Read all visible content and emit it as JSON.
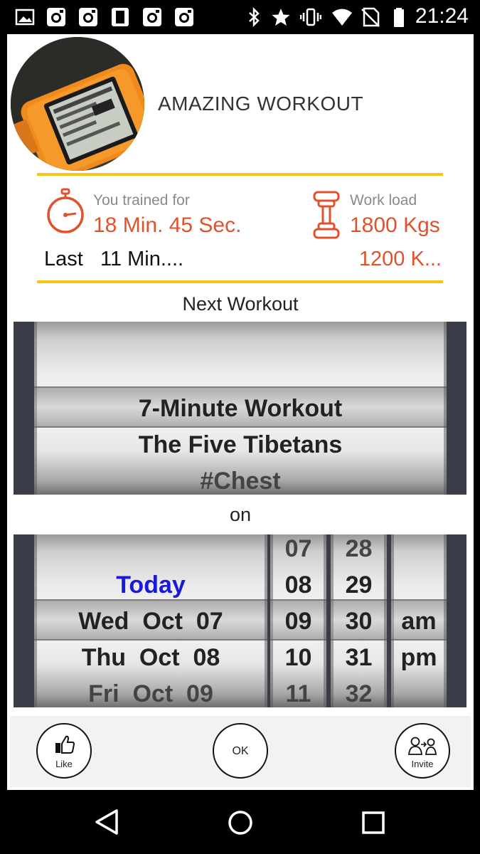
{
  "status_bar": {
    "time": "21:24",
    "left_icons": [
      "image-icon",
      "instagram-icon",
      "instagram-icon",
      "phone-frame-icon",
      "instagram-icon",
      "instagram-icon"
    ],
    "right_icons": [
      "bluetooth-icon",
      "star-icon",
      "vibrate-icon",
      "wifi-icon",
      "no-sim-icon",
      "battery-icon"
    ]
  },
  "header": {
    "title": "AMAZING WORKOUT"
  },
  "stats": {
    "trained_label": "You trained for",
    "trained_value": "18 Min. 45 Sec.",
    "last_label": "Last   11 Min....",
    "load_label": "Work load",
    "load_value": "1800 Kgs",
    "last_load": "1200 K..."
  },
  "next_workout": {
    "heading": "Next Workout",
    "options": [
      "7-Minute Workout",
      "The Five Tibetans",
      "#Chest"
    ],
    "selected": "7-Minute Workout"
  },
  "on_label": "on",
  "date_picker": {
    "days": [
      "Today",
      "Wed  Oct  07",
      "Thu  Oct  08",
      "Fri  Oct  09"
    ],
    "hours": [
      "07",
      "08",
      "09",
      "10",
      "11"
    ],
    "minutes": [
      "28",
      "29",
      "30",
      "31",
      "32"
    ],
    "ampm": [
      "am",
      "pm"
    ],
    "selected": {
      "day": "Wed  Oct  07",
      "hour": "09",
      "minute": "30",
      "ampm": "am"
    }
  },
  "actions": {
    "like_label": "Like",
    "ok_label": "OK",
    "invite_label": "Invite"
  },
  "colors": {
    "accent": "#e0522c",
    "rule": "#f5c518",
    "today": "#1a1ad6"
  }
}
